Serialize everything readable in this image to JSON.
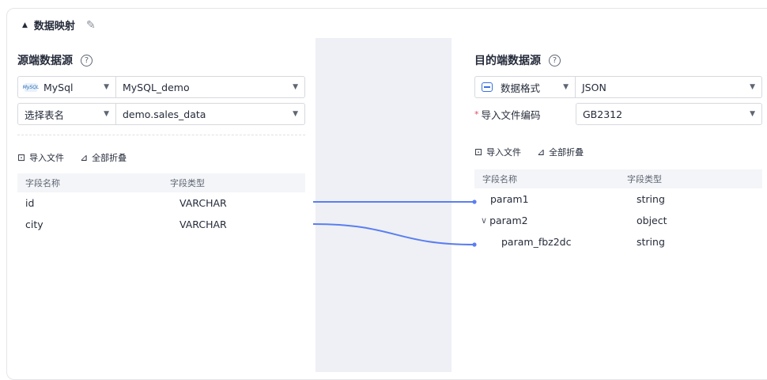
{
  "section": {
    "title": "数据映射"
  },
  "source": {
    "title": "源端数据源",
    "type": "MySql",
    "type_badge": "MySQL",
    "connection": "MySQL_demo",
    "table_label": "选择表名",
    "table": "demo.sales_data",
    "tools": {
      "import": "导入文件",
      "collapse": "全部折叠"
    },
    "columns": {
      "name": "字段名称",
      "type": "字段类型"
    },
    "fields": [
      {
        "name": "id",
        "type": "VARCHAR"
      },
      {
        "name": "city",
        "type": "VARCHAR"
      }
    ]
  },
  "target": {
    "title": "目的端数据源",
    "type": "数据格式",
    "format": "JSON",
    "encoding_label": "导入文件编码",
    "encoding": "GB2312",
    "tools": {
      "import": "导入文件",
      "collapse": "全部折叠"
    },
    "columns": {
      "name": "字段名称",
      "type": "字段类型"
    },
    "fields": [
      {
        "name": "param1",
        "type": "string"
      },
      {
        "name": "param2",
        "type": "object",
        "expanded": true
      },
      {
        "name": "param_fbz2dc",
        "type": "string",
        "child": true
      }
    ]
  },
  "mappings": [
    {
      "from": "id",
      "to": "param1"
    },
    {
      "from": "city",
      "to": "param_fbz2dc"
    }
  ],
  "colors": {
    "link": "#5b7ef0",
    "accent": "#3a6fe0",
    "required": "#e34a5f"
  }
}
